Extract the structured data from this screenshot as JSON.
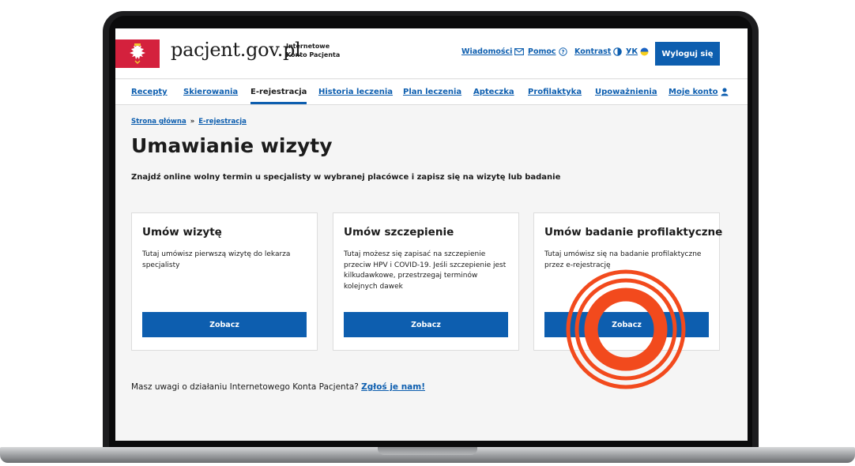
{
  "colors": {
    "primary": "#0d5eaf",
    "emblem_red": "#d4213d",
    "highlight_orange": "#f24a1d"
  },
  "header": {
    "logo_text": "pacjent.gov.pl",
    "logo_sub_line1": "Internetowe",
    "logo_sub_line2": "Konto Pacjenta",
    "emblem_icon": "white-eagle-icon",
    "links": {
      "messages": "Wiadomości",
      "help": "Pomoc",
      "contrast": "Kontrast",
      "language": "УК"
    },
    "logout": "Wyloguj się"
  },
  "nav": {
    "items": [
      {
        "label": "Recepty"
      },
      {
        "label": "Skierowania"
      },
      {
        "label": "E-rejestracja",
        "active": true
      },
      {
        "label": "Historia leczenia"
      },
      {
        "label": "Plan leczenia"
      },
      {
        "label": "Apteczka"
      },
      {
        "label": "Profilaktyka"
      },
      {
        "label": "Upoważnienia"
      },
      {
        "label": "Moje konto"
      }
    ]
  },
  "breadcrumb": {
    "home": "Strona główna",
    "separator": "»",
    "current": "E-rejestracja"
  },
  "page": {
    "title": "Umawianie wizyty",
    "lead": "Znajdź online wolny termin u specjalisty w wybranej placówce i zapisz się na wizytę lub badanie"
  },
  "cards": [
    {
      "title": "Umów wizytę",
      "text": "Tutaj umówisz pierwszą wizytę do lekarza specjalisty",
      "button": "Zobacz"
    },
    {
      "title": "Umów szczepienie",
      "text": "Tutaj możesz się zapisać na szczepienie przeciw HPV i COVID-19. Jeśli szczepienie jest kilkudawkowe, przestrzegaj terminów kolejnych dawek",
      "button": "Zobacz"
    },
    {
      "title": "Umów badanie profilaktyczne",
      "text": "Tutaj umówisz się na badanie profilaktyczne przez e-rejestrację",
      "button": "Zobacz"
    }
  ],
  "feedback": {
    "text": "Masz uwagi o działaniu Internetowego Konta Pacjenta?",
    "link": "Zgłoś je nam!"
  }
}
